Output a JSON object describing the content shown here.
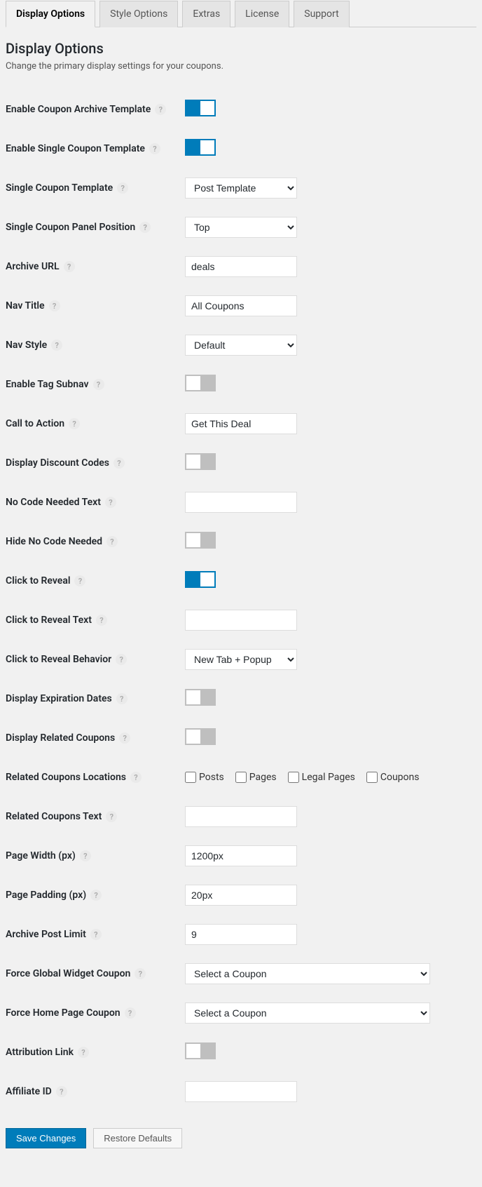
{
  "tabs": [
    {
      "label": "Display Options",
      "active": true
    },
    {
      "label": "Style Options",
      "active": false
    },
    {
      "label": "Extras",
      "active": false
    },
    {
      "label": "License",
      "active": false
    },
    {
      "label": "Support",
      "active": false
    }
  ],
  "heading": "Display Options",
  "description": "Change the primary display settings for your coupons.",
  "fields": {
    "enable_archive": {
      "label": "Enable Coupon Archive Template"
    },
    "enable_single": {
      "label": "Enable Single Coupon Template"
    },
    "single_template": {
      "label": "Single Coupon Template",
      "value": "Post Template"
    },
    "panel_position": {
      "label": "Single Coupon Panel Position",
      "value": "Top"
    },
    "archive_url": {
      "label": "Archive URL",
      "value": "deals"
    },
    "nav_title": {
      "label": "Nav Title",
      "value": "All Coupons"
    },
    "nav_style": {
      "label": "Nav Style",
      "value": "Default"
    },
    "tag_subnav": {
      "label": "Enable Tag Subnav"
    },
    "cta": {
      "label": "Call to Action",
      "value": "Get This Deal"
    },
    "display_codes": {
      "label": "Display Discount Codes"
    },
    "no_code_text": {
      "label": "No Code Needed Text",
      "value": ""
    },
    "hide_no_code": {
      "label": "Hide No Code Needed"
    },
    "click_reveal": {
      "label": "Click to Reveal"
    },
    "click_reveal_text": {
      "label": "Click to Reveal Text",
      "value": ""
    },
    "click_reveal_behavior": {
      "label": "Click to Reveal Behavior",
      "value": "New Tab + Popup"
    },
    "expiration": {
      "label": "Display Expiration Dates"
    },
    "related_coupons": {
      "label": "Display Related Coupons"
    },
    "related_locations": {
      "label": "Related Coupons Locations"
    },
    "related_text": {
      "label": "Related Coupons Text",
      "value": ""
    },
    "page_width": {
      "label": "Page Width (px)",
      "value": "1200px"
    },
    "page_padding": {
      "label": "Page Padding (px)",
      "value": "20px"
    },
    "archive_limit": {
      "label": "Archive Post Limit",
      "value": "9"
    },
    "force_global": {
      "label": "Force Global Widget Coupon",
      "value": "Select a Coupon"
    },
    "force_home": {
      "label": "Force Home Page Coupon",
      "value": "Select a Coupon"
    },
    "attribution": {
      "label": "Attribution Link"
    },
    "affiliate_id": {
      "label": "Affiliate ID",
      "value": ""
    }
  },
  "locations": {
    "posts": "Posts",
    "pages": "Pages",
    "legal": "Legal Pages",
    "coupons": "Coupons"
  },
  "buttons": {
    "save": "Save Changes",
    "restore": "Restore Defaults"
  }
}
